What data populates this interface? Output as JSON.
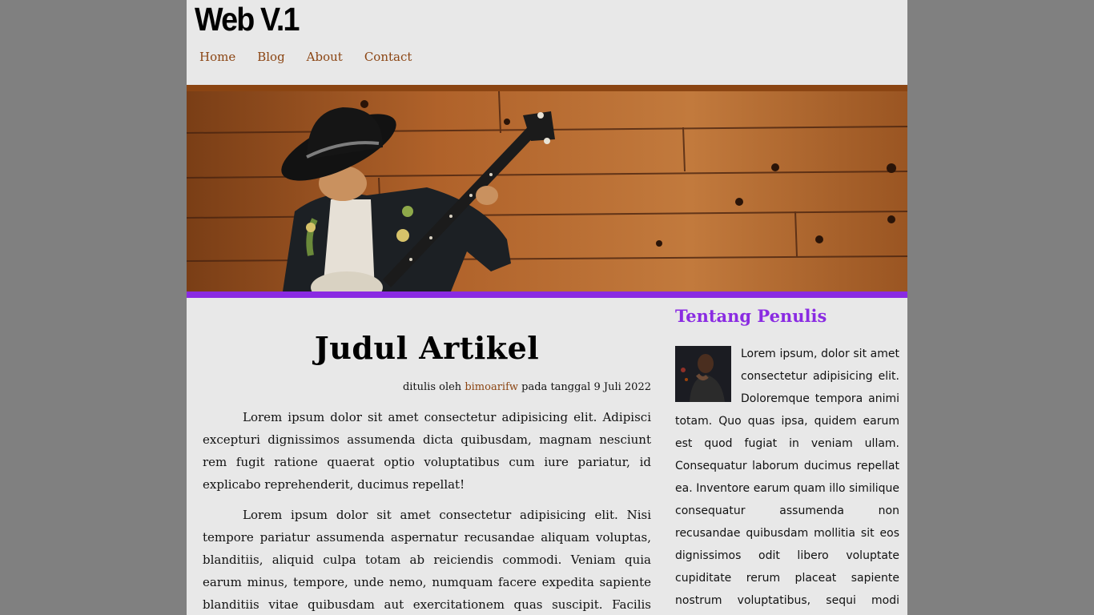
{
  "header": {
    "brand": "Web V.1",
    "nav": [
      "Home",
      "Blog",
      "About",
      "Contact"
    ]
  },
  "colors": {
    "accent_link": "#8b4513",
    "accent_purple": "#8a2be2",
    "page_bg": "#e8e8e8",
    "outer_bg": "#808080"
  },
  "article": {
    "title": "Judul Artikel",
    "byline_prefix": "ditulis oleh ",
    "author": "bimoarifw",
    "byline_suffix": " pada tanggal 9 Juli 2022",
    "paragraphs": [
      "Lorem ipsum dolor sit amet consectetur adipisicing elit. Adipisci excepturi dignissimos assumenda dicta quibusdam, magnam nesciunt rem fugit ratione quaerat optio voluptatibus cum iure pariatur, id explicabo reprehenderit, ducimus repellat!",
      "Lorem ipsum dolor sit amet consectetur adipisicing elit. Nisi tempore pariatur assumenda aspernatur recusandae aliquam voluptas, blanditiis, aliquid culpa totam ab reiciendis commodi. Veniam quia earum minus, tempore, unde nemo, numquam facere expedita sapiente blanditiis vitae quibusdam aut exercitationem quas suscipit. Facilis tenetur tempora rerum."
    ]
  },
  "aside": {
    "heading": "Tentang Penulis",
    "bio": "Lorem ipsum, dolor sit amet consectetur adipisicing elit. Doloremque tempora animi totam. Quo quas ipsa, quidem earum est quod fugiat in veniam ullam. Consequatur laborum ducimus repellat ea. Inventore earum quam illo similique consequatur assumenda non recusandae quibusdam mollitia sit eos dignissimos odit libero voluptate cupiditate rerum placeat sapiente nostrum voluptatibus, sequi modi commodi asperiores nulla accusamus."
  }
}
